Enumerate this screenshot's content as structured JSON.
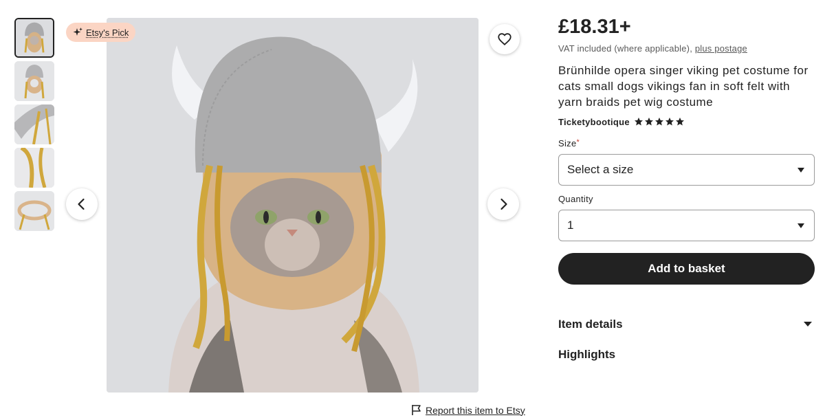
{
  "gallery": {
    "badge_label": "Etsy's Pick",
    "thumbnails": [
      {
        "id": "thumb-1",
        "active": true
      },
      {
        "id": "thumb-2",
        "active": false
      },
      {
        "id": "thumb-3",
        "active": false
      },
      {
        "id": "thumb-4",
        "active": false
      },
      {
        "id": "thumb-5",
        "active": false
      }
    ],
    "icons": {
      "favorite": "heart-icon",
      "prev": "chevron-left-icon",
      "next": "chevron-right-icon",
      "badge": "sparkle-icon",
      "report": "flag-icon"
    }
  },
  "report_link": "Report this item to Etsy",
  "listing": {
    "price": "£18.31+",
    "vat_text": "VAT included (where applicable),",
    "postage_link": "plus postage",
    "title": "Brünhilde opera singer viking pet costume for cats small dogs vikings fan in soft felt with yarn braids pet wig costume",
    "shop_name": "Ticketybootique",
    "rating": 5,
    "size_label": "Size",
    "size_required_mark": "*",
    "size_value": "Select a size",
    "quantity_label": "Quantity",
    "quantity_value": "1",
    "add_to_basket": "Add to basket",
    "item_details": "Item details",
    "highlights": "Highlights"
  },
  "colors": {
    "primary_button": "#222222",
    "badge_bg": "#fbd5c4",
    "text": "#222222",
    "muted": "#595959"
  }
}
